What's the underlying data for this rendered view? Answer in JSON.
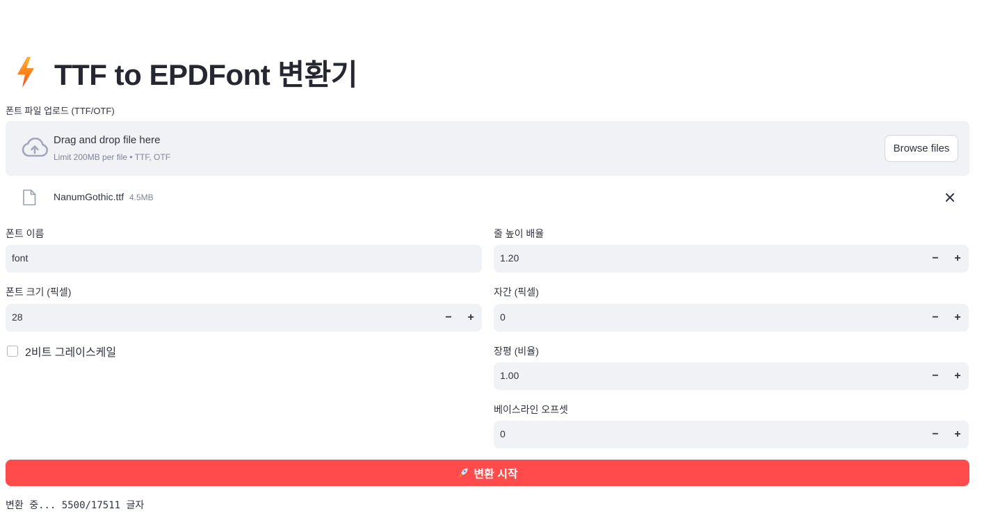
{
  "header": {
    "title": "TTF to EPDFont 변환기",
    "icon": "lightning-icon"
  },
  "uploader": {
    "label": "폰트 파일 업로드 (TTF/OTF)",
    "drop_title": "Drag and drop file here",
    "drop_sub": "Limit 200MB per file • TTF, OTF",
    "browse_label": "Browse files",
    "icon": "cloud-upload-icon",
    "file": {
      "name": "NanumGothic.ttf",
      "size": "4.5MB",
      "icon": "file-icon",
      "remove_icon": "close-icon"
    }
  },
  "fields": {
    "font_name": {
      "label": "폰트 이름",
      "value": "font"
    },
    "line_height": {
      "label": "줄 높이 배율",
      "value": "1.20"
    },
    "font_size": {
      "label": "폰트 크기 (픽셀)",
      "value": "28"
    },
    "letter_spacing": {
      "label": "자간 (픽셀)",
      "value": "0"
    },
    "aspect": {
      "label": "장평 (비율)",
      "value": "1.00"
    },
    "baseline": {
      "label": "베이스라인 오프셋",
      "value": "0"
    },
    "grayscale": {
      "label": "2비트 그레이스케일",
      "checked": false
    }
  },
  "stepper": {
    "minus": "−",
    "plus": "+"
  },
  "convert_button": {
    "label": "변환 시작",
    "icon": "rocket-icon"
  },
  "status": {
    "text": "변환 중... 5500/17511 글자"
  },
  "colors": {
    "primary": "#ff4b4b",
    "input_bg": "#f0f2f6",
    "text": "#31333f",
    "muted": "#808495"
  }
}
